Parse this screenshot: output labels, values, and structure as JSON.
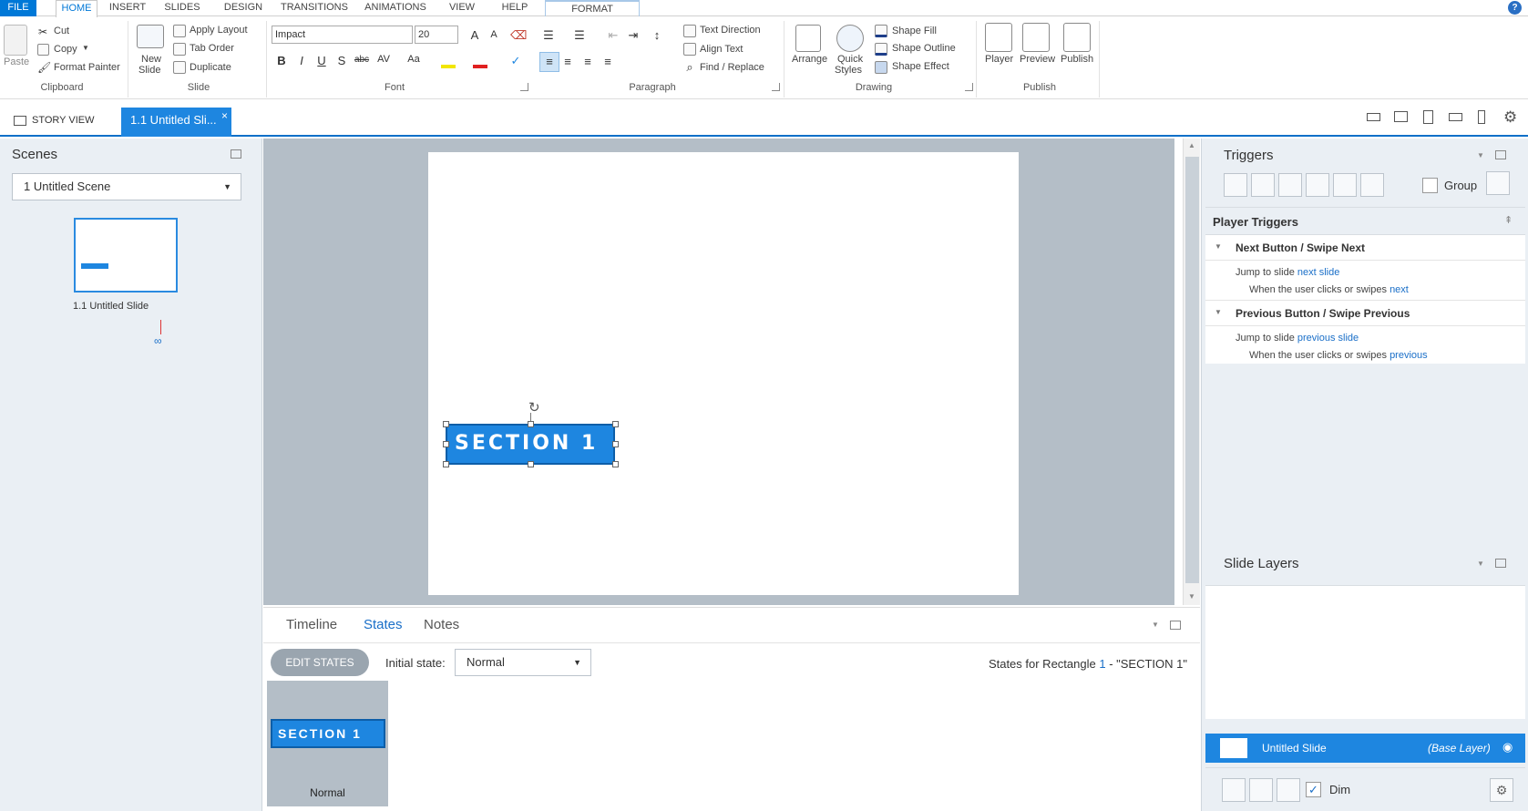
{
  "menu": {
    "file": "FILE",
    "home": "HOME",
    "insert": "INSERT",
    "slides": "SLIDES",
    "design": "DESIGN",
    "transitions": "TRANSITIONS",
    "animations": "ANIMATIONS",
    "view": "VIEW",
    "help": "HELP",
    "format": "FORMAT",
    "help_icon": "?"
  },
  "ribbon": {
    "clipboard": {
      "paste": "Paste",
      "cut": "Cut",
      "copy": "Copy",
      "format_painter": "Format Painter",
      "label": "Clipboard"
    },
    "slide": {
      "new_slide_1": "New",
      "new_slide_2": "Slide",
      "apply_layout": "Apply Layout",
      "tab_order": "Tab Order",
      "duplicate": "Duplicate",
      "label": "Slide"
    },
    "font": {
      "family": "Impact",
      "size": "20",
      "label": "Font",
      "bold": "B",
      "italic": "I",
      "underline": "U",
      "shadow": "S",
      "strike": "abc",
      "spacing": "AV",
      "case": "Aa",
      "grow": "A",
      "shrink": "A"
    },
    "paragraph": {
      "text_direction": "Text Direction",
      "align_text": "Align Text",
      "find_replace": "Find / Replace",
      "label": "Paragraph"
    },
    "drawing": {
      "arrange": "Arrange",
      "quick_1": "Quick",
      "quick_2": "Styles",
      "shape_fill": "Shape Fill",
      "shape_outline": "Shape Outline",
      "shape_effect": "Shape Effect",
      "label": "Drawing"
    },
    "publish": {
      "player": "Player",
      "preview": "Preview",
      "publish": "Publish",
      "label": "Publish"
    }
  },
  "tabs": {
    "story_view": "STORY VIEW",
    "slide_tab": "1.1 Untitled Sli...",
    "close": "×"
  },
  "scenes": {
    "title": "Scenes",
    "selected_scene": "1 Untitled Scene",
    "slide_label": "1.1 Untitled Slide"
  },
  "canvas": {
    "shape_text": "SECTION 1"
  },
  "bottom": {
    "tabs": [
      "Timeline",
      "States",
      "Notes"
    ],
    "edit_states": "EDIT STATES",
    "initial_state_label": "Initial state:",
    "initial_state_value": "Normal",
    "states_for_prefix": "States for Rectangle ",
    "states_for_num": "1",
    "states_for_suffix": " - \"SECTION 1\"",
    "state_shape_text": "SECTION 1",
    "state_name": "Normal"
  },
  "triggers": {
    "title": "Triggers",
    "group_label": "Group",
    "player_triggers": "Player Triggers",
    "items": [
      {
        "heading": "Next Button / Swipe Next",
        "action_prefix": "Jump to slide ",
        "action_link": "next slide",
        "when_prefix": "When the user clicks or swipes ",
        "when_link": "next"
      },
      {
        "heading": "Previous Button / Swipe Previous",
        "action_prefix": "Jump to slide ",
        "action_link": "previous slide",
        "when_prefix": "When the user clicks or swipes ",
        "when_link": "previous"
      }
    ]
  },
  "layers": {
    "title": "Slide Layers",
    "base_name": "Untitled Slide",
    "base_tag": "(Base Layer)",
    "dim_label": "Dim"
  },
  "colors": {
    "accent": "#1e86e0",
    "panel_bg": "#eaeff4",
    "canvas_bg": "#b4bec7"
  }
}
